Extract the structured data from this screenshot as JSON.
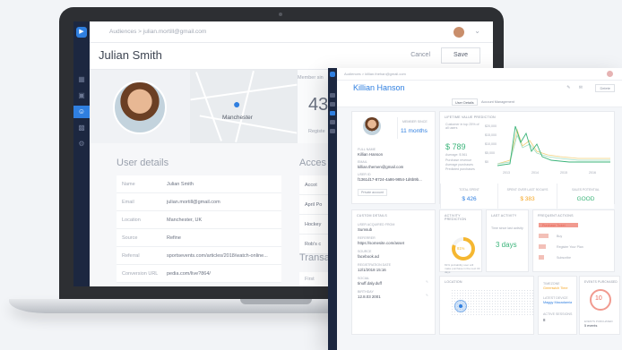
{
  "laptop": {
    "breadcrumb": "Audiences  >  julian.mortill@gmail.com",
    "user_name": "Julian Smith",
    "cancel_label": "Cancel",
    "save_label": "Save",
    "map_city": "Manchester",
    "stat_label": "Member sin",
    "stat_value": "43",
    "stat_sub": "Registe",
    "user_details_title": "User details",
    "details": [
      {
        "label": "Name",
        "value": "Julian Smith"
      },
      {
        "label": "Email",
        "value": "julian.mortill@gmail.com"
      },
      {
        "label": "Location",
        "value": "Manchester, UK"
      },
      {
        "label": "Source",
        "value": "Refine"
      },
      {
        "label": "Referral",
        "value": "sportsevents.com/articles/2018/watch-online..."
      },
      {
        "label": "Conversion URL",
        "value": "pedia.com/live?864/"
      }
    ],
    "accounts_title": "Acces",
    "accounts": [
      "Accot",
      "April Po",
      "Hockey",
      "Rob's c"
    ],
    "transactions_title": "Transact",
    "transactions_first": "First"
  },
  "dashboard": {
    "breadcrumb": "Audiences  >  killian.thehan@gmail.com",
    "name": "Killian Hanson",
    "delete_label": "Delete",
    "tabs": [
      "User Details",
      "Account Management"
    ],
    "profile": {
      "member_since_label": "MEMBER SINCE",
      "member_since": "11 months",
      "fields": [
        {
          "label": "FULL NAME",
          "value": "Killian Hanson"
        },
        {
          "label": "EMAIL",
          "value": "killian.themen@gmail.com"
        },
        {
          "label": "USER ID",
          "value": "f1361d17-8724-4a86-9854-1d6b9b..."
        }
      ],
      "button": "Private account"
    },
    "ltv": {
      "title": "LIFETIME VALUE PREDICTION",
      "note": "Customer in top 25% of all users",
      "value": "$ 789",
      "sub": "Average: $ 561",
      "legend": [
        "Purchase revenue",
        "Average purchases",
        "Predicted purchases"
      ],
      "y_ticks": [
        "$20,000",
        "$15,000",
        "$10,000",
        "$5,000",
        "$0"
      ],
      "x_ticks": [
        "2013",
        "2014",
        "2015",
        "2016"
      ]
    },
    "minis": [
      {
        "label": "TOTAL SPENT",
        "value": "$ 426",
        "color": "#2f7fe0"
      },
      {
        "label": "SPENT OVER LAST 90 DAYS",
        "value": "$ 383",
        "color": "#f5a623"
      },
      {
        "label": "SALES POTENTIAL",
        "value": "GOOD",
        "color": "#3bb47a"
      }
    ],
    "custom": {
      "title": "CUSTOM DETAILS",
      "fields": [
        {
          "label": "USER ACQUIRED FROM",
          "value": "Sumsub"
        },
        {
          "label": "REFERRER",
          "value": "https://somesite.com/asset"
        },
        {
          "label": "SOURCE",
          "value": "facebook.ad"
        },
        {
          "label": "REGISTRATION DATE",
          "value": "12/1/2018 15:16"
        },
        {
          "label": "SOCIAL",
          "value": "tinuff.daly.duff"
        },
        {
          "label": "BIRTHDAY",
          "value": "12.8.03 2001"
        }
      ]
    },
    "activity": {
      "title": "ACTIVITY PREDICTION",
      "gauge": "81%",
      "note": "81% probability user will make purchase in the next 30 days"
    },
    "last_activity": {
      "title": "LAST ACTIVITY",
      "sub": "Time since last activity",
      "value": "3 days"
    },
    "frequent": {
      "title": "FREQUENT ACTIONS",
      "items": [
        {
          "label": "Purchase Ticket",
          "pct": 0.78,
          "color": "#f19a8f"
        },
        {
          "label": "Buy",
          "pct": 0.2,
          "color": "#f3c0b8"
        },
        {
          "label": "Register Your Plan",
          "pct": 0.14,
          "color": "#f3c0b8"
        },
        {
          "label": "Subscribe",
          "pct": 0.1,
          "color": "#f3c0b8"
        }
      ]
    },
    "location": {
      "title": "LOCATION"
    },
    "timezone": {
      "timezone_label": "TIMEZONE",
      "timezone": "Greenwich Time",
      "device_label": "LATEST DEVICE",
      "device": "Maggy Macadamia",
      "sessions_label": "ACTIVE SESSIONS",
      "sessions": "8"
    },
    "events": {
      "title": "EVENTS PURCHASED",
      "value": "10",
      "footer_label": "EVENTS PURCHASED",
      "footer": "5 events"
    }
  }
}
